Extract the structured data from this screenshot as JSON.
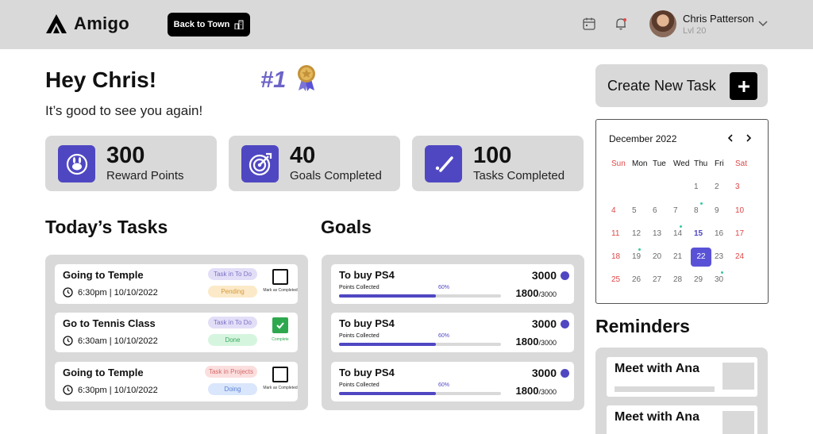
{
  "app": {
    "brand": "Amigo",
    "back_button": "Back to Town"
  },
  "user": {
    "name": "Chris Patterson",
    "level": "Lvl 20"
  },
  "welcome": {
    "greeting": "Hey Chris!",
    "rank": "#1",
    "subtitle": "It’s good to see you again!"
  },
  "stats": [
    {
      "value": "300",
      "label": "Reward Points",
      "icon": "bunny-icon"
    },
    {
      "value": "40",
      "label": "Goals Completed",
      "icon": "target-icon"
    },
    {
      "value": "100",
      "label": "Tasks Completed",
      "icon": "check-icon"
    }
  ],
  "tasks": {
    "title": "Today’s Tasks",
    "items": [
      {
        "title": "Going to Temple",
        "time": "6:30pm | 10/10/2022",
        "category": "Task in To Do",
        "status": "Pending",
        "check_label": "Mark as Completed",
        "done": false
      },
      {
        "title": "Go to Tennis Class",
        "time": "6:30am | 10/10/2022",
        "category": "Task in To Do",
        "status": "Done",
        "check_label": "Complete",
        "done": true
      },
      {
        "title": "Going to Temple",
        "time": "6:30pm | 10/10/2022",
        "category": "Task in Projects",
        "status": "Doing",
        "check_label": "Mark as Completed",
        "done": false
      }
    ]
  },
  "goals": {
    "title": "Goals",
    "items": [
      {
        "title": "To buy PS4",
        "points": "3000",
        "sub": "Points Collected",
        "percent": "60%",
        "progress": 0.6,
        "current": "1800",
        "max": "/3000"
      },
      {
        "title": "To buy PS4",
        "points": "3000",
        "sub": "Points Collected",
        "percent": "60%",
        "progress": 0.6,
        "current": "1800",
        "max": "/3000"
      },
      {
        "title": "To buy PS4",
        "points": "3000",
        "sub": "Points Collected",
        "percent": "60%",
        "progress": 0.6,
        "current": "1800",
        "max": "/3000"
      }
    ]
  },
  "create_task": {
    "label": "Create New Task"
  },
  "calendar": {
    "month": "December 2022",
    "weekdays": [
      "Sun",
      "Mon",
      "Tue",
      "Wed",
      "Thu",
      "Fri",
      "Sat"
    ],
    "weeks": [
      [
        "",
        "",
        "",
        "",
        "1",
        "2",
        "3"
      ],
      [
        "4",
        "5",
        "6",
        "7",
        "8",
        "9",
        "10"
      ],
      [
        "11",
        "12",
        "13",
        "14",
        "15",
        "16",
        "17"
      ],
      [
        "18",
        "19",
        "20",
        "21",
        "22",
        "23",
        "24"
      ],
      [
        "25",
        "26",
        "27",
        "28",
        "29",
        "30",
        ""
      ]
    ],
    "today": "15",
    "selected": "22",
    "event_days": [
      "8",
      "14",
      "19",
      "30"
    ]
  },
  "reminders": {
    "title": "Reminders",
    "items": [
      {
        "title": "Meet with Ana"
      },
      {
        "title": "Meet with Ana"
      }
    ]
  },
  "colors": {
    "accent": "#4f47c2",
    "panel": "#d9d9d9",
    "weekend": "#e04848",
    "event_dot": "#38c7a0",
    "done": "#2ea84f"
  }
}
